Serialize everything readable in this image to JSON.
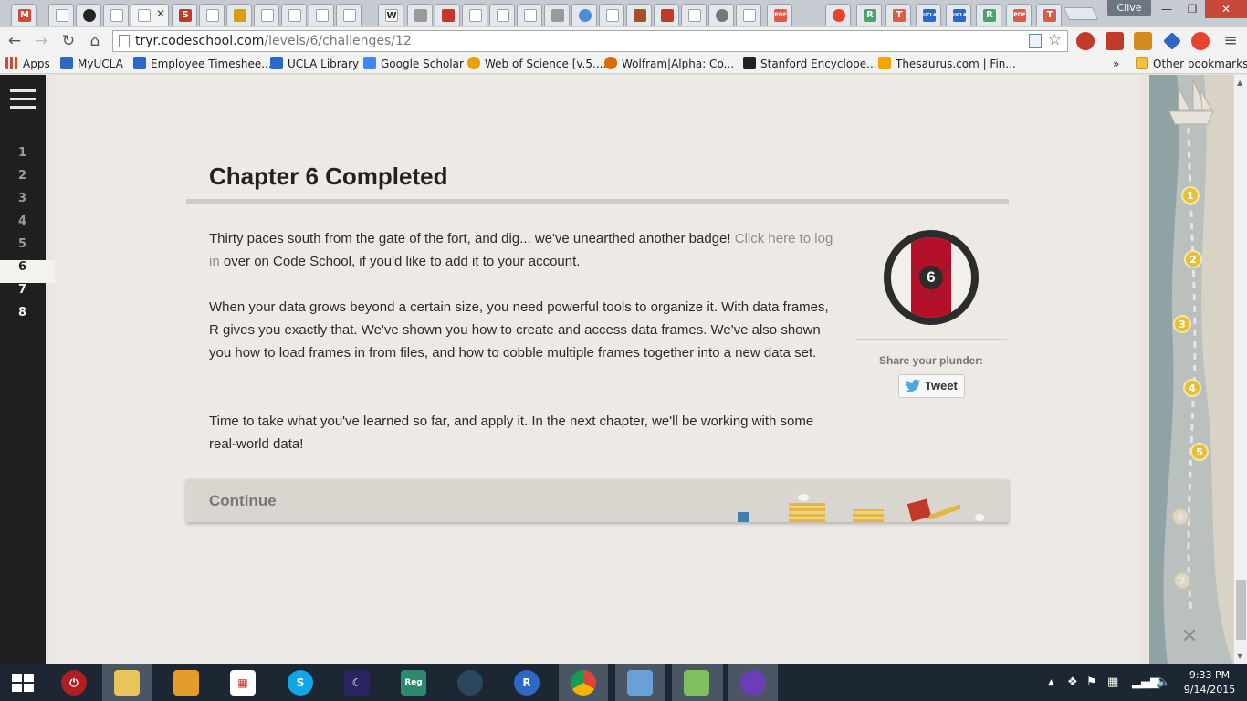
{
  "browser": {
    "profile_name": "Clive",
    "url_host": "tryr.codeschool.com",
    "url_path": "/levels/6/challenges/12",
    "window_controls": {
      "minimize": "—",
      "restore": "❐",
      "close": "✕"
    }
  },
  "bookmarks": [
    {
      "label": "Apps",
      "color": "#d14836"
    },
    {
      "label": "MyUCLA",
      "color": "#2d68c4"
    },
    {
      "label": "Employee Timeshee...",
      "color": "#2d68c4"
    },
    {
      "label": "UCLA Library",
      "color": "#2d68c4"
    },
    {
      "label": "Google Scholar",
      "color": "#4285f4"
    },
    {
      "label": "Web of Science [v.5....",
      "color": "#e8a000"
    },
    {
      "label": "Wolfram|Alpha: Co...",
      "color": "#dd1100"
    },
    {
      "label": "Stanford Encyclope...",
      "color": "#222222"
    },
    {
      "label": "Thesaurus.com | Fin...",
      "color": "#f0a500"
    }
  ],
  "bookmarks_overflow": "»",
  "other_bookmarks": "Other bookmarks",
  "sidebar": {
    "chapters": [
      "1",
      "2",
      "3",
      "4",
      "5",
      "6",
      "7",
      "8"
    ],
    "current": "6"
  },
  "content": {
    "title": "Chapter 6 Completed",
    "p1_text": "Thirty paces south from the gate of the fort, and dig... we've unearthed another badge! ",
    "p1_link": "Click here to log in",
    "p1_tail": " over on Code School, if you'd like to add it to your account.",
    "p2": "When your data grows beyond a certain size, you need powerful tools to organize it. With data frames, R gives you exactly that. We've shown you how to create and access data frames. We've also shown you how to load frames in from files, and how to cobble multiple frames together into a new data set.",
    "p3": "Time to take what you've learned so far, and apply it. In the next chapter, we'll be working with some real-world data!",
    "badge_number": "6",
    "share_label": "Share your plunder:",
    "tweet_label": "Tweet",
    "continue_label": "Continue"
  },
  "map": {
    "markers": [
      "1",
      "2",
      "3",
      "4",
      "5",
      "6",
      "7"
    ],
    "end_marker": "✕"
  },
  "taskbar": {
    "time": "9:33 PM",
    "date": "9/14/2015",
    "apps": [
      "start",
      "power",
      "file-explorer",
      "folder",
      "apps-grid",
      "skype",
      "stellarium",
      "registax",
      "steam",
      "r",
      "chrome",
      "control-panel",
      "battery",
      "cat"
    ]
  },
  "colors": {
    "accent_red": "#b5102a",
    "sidebar_bg": "#1f1f1f",
    "marker_gold": "#e4bf3a"
  }
}
